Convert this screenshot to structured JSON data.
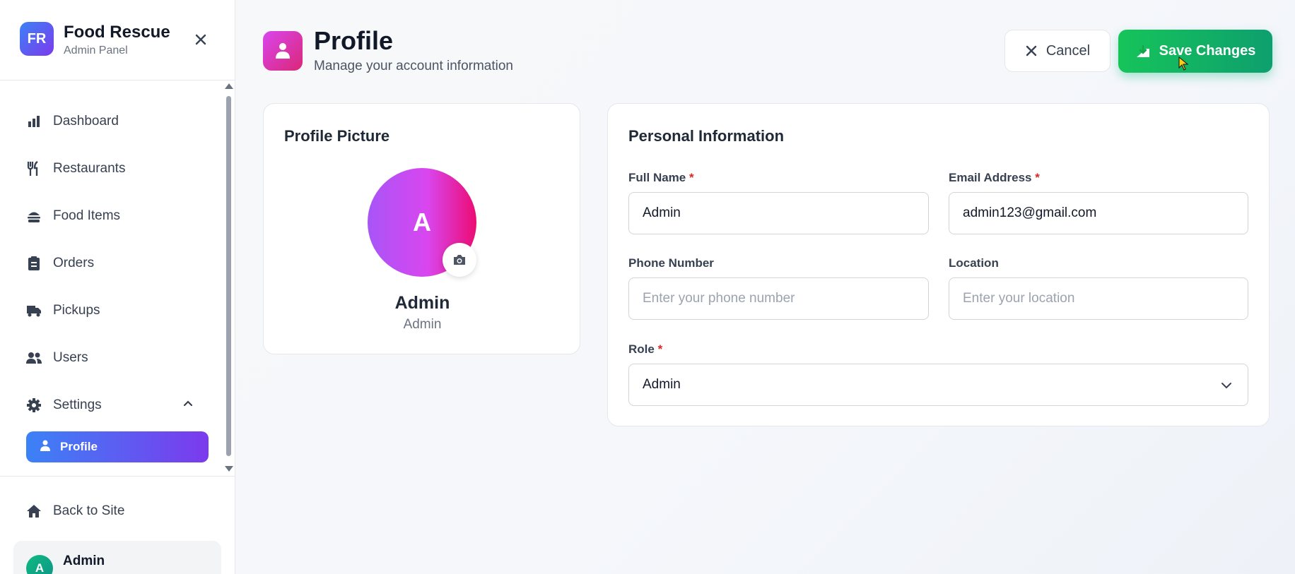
{
  "sidebar": {
    "brand": {
      "logo": "FR",
      "title": "Food Rescue",
      "subtitle": "Admin Panel"
    },
    "items": [
      {
        "label": "Dashboard",
        "icon": "bar-chart-icon"
      },
      {
        "label": "Restaurants",
        "icon": "utensils-icon"
      },
      {
        "label": "Food Items",
        "icon": "hamburger-icon"
      },
      {
        "label": "Orders",
        "icon": "clipboard-icon"
      },
      {
        "label": "Pickups",
        "icon": "truck-icon"
      },
      {
        "label": "Users",
        "icon": "users-icon"
      },
      {
        "label": "Settings",
        "icon": "gear-icon"
      }
    ],
    "active_sub": {
      "label": "Profile",
      "icon": "user-icon"
    },
    "back_label": "Back to Site",
    "user": {
      "initial": "A",
      "name": "Admin"
    }
  },
  "header": {
    "title": "Profile",
    "subtitle": "Manage your account information",
    "cancel_label": "Cancel",
    "save_label": "Save Changes"
  },
  "profile_picture": {
    "title": "Profile Picture",
    "initial": "A",
    "name": "Admin",
    "role": "Admin"
  },
  "personal_info": {
    "title": "Personal Information",
    "full_name": {
      "label": "Full Name",
      "required": "*",
      "value": "Admin"
    },
    "email": {
      "label": "Email Address",
      "required": "*",
      "value": "admin123@gmail.com"
    },
    "phone": {
      "label": "Phone Number",
      "placeholder": "Enter your phone number"
    },
    "location": {
      "label": "Location",
      "placeholder": "Enter your location"
    },
    "role": {
      "label": "Role",
      "required": "*",
      "value": "Admin"
    }
  },
  "colors": {
    "accent_blue": "#3b82f6",
    "accent_purple": "#7c3aed",
    "save_green": "#16c45a",
    "profile_pink": "#db2777",
    "required_red": "#dc2626"
  }
}
